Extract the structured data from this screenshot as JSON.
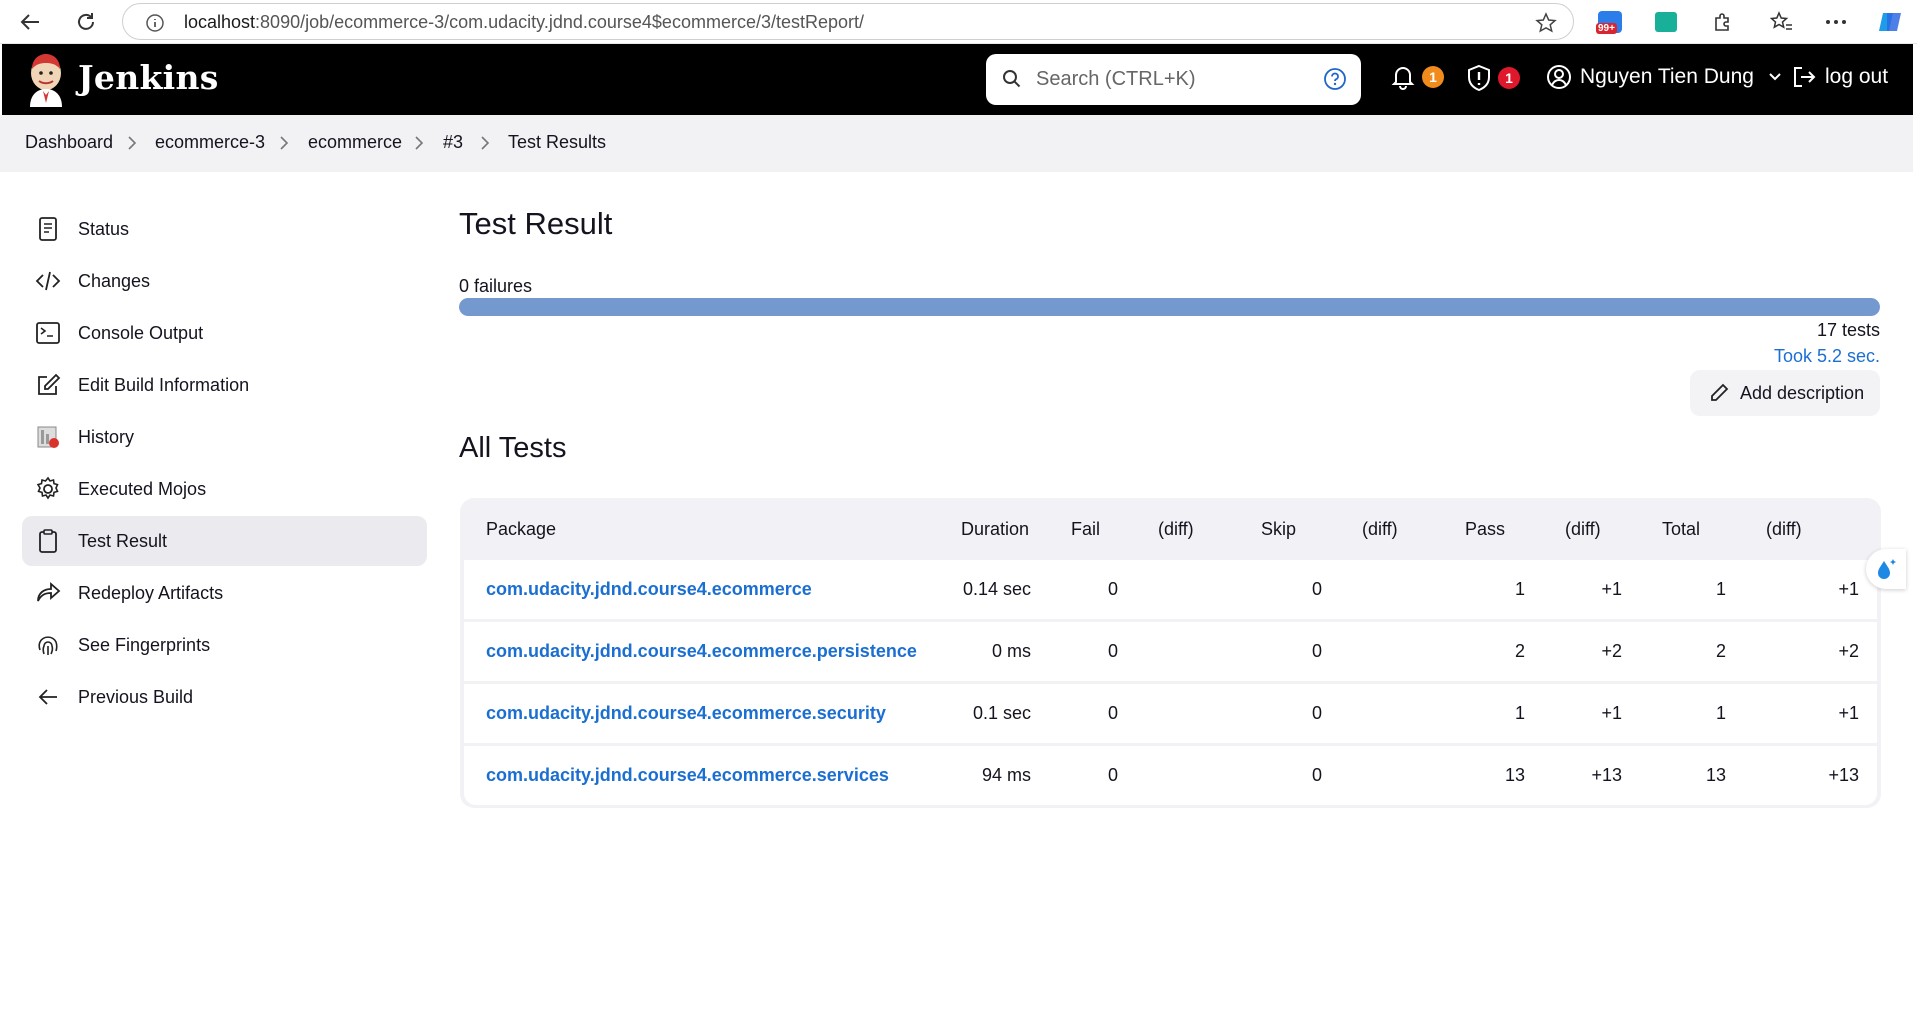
{
  "browser": {
    "url_host": "localhost",
    "url_rest": ":8090/job/ecommerce-3/com.udacity.jdnd.course4$ecommerce/3/testReport/",
    "ext_badge": "99+"
  },
  "header": {
    "brand": "Jenkins",
    "search_placeholder": "Search (CTRL+K)",
    "notifications_count": "1",
    "security_count": "1",
    "user_name": "Nguyen Tien Dung",
    "logout_label": "log out"
  },
  "breadcrumb": [
    "Dashboard",
    "ecommerce-3",
    "ecommerce",
    "#3",
    "Test Results"
  ],
  "sidebar": {
    "items": [
      {
        "label": "Status",
        "icon": "document-icon"
      },
      {
        "label": "Changes",
        "icon": "code-icon"
      },
      {
        "label": "Console Output",
        "icon": "terminal-icon"
      },
      {
        "label": "Edit Build Information",
        "icon": "edit-icon"
      },
      {
        "label": "History",
        "icon": "history-icon"
      },
      {
        "label": "Executed Mojos",
        "icon": "gear-icon"
      },
      {
        "label": "Test Result",
        "icon": "clipboard-icon"
      },
      {
        "label": "Redeploy Artifacts",
        "icon": "redeploy-icon"
      },
      {
        "label": "See Fingerprints",
        "icon": "fingerprint-icon"
      },
      {
        "label": "Previous Build",
        "icon": "arrow-left-icon"
      }
    ]
  },
  "main": {
    "title": "Test Result",
    "failures_text": "0 failures",
    "fail_ratio": 0,
    "tests_text": "17 tests",
    "took_text": "Took 5.2 sec.",
    "add_description": "Add description",
    "all_tests_title": "All Tests"
  },
  "table": {
    "headers": [
      "Package",
      "Duration",
      "Fail",
      "(diff)",
      "Skip",
      "(diff)",
      "Pass",
      "(diff)",
      "Total",
      "(diff)"
    ],
    "rows": [
      {
        "package": "com.udacity.jdnd.course4.ecommerce",
        "duration": "0.14 sec",
        "fail": "0",
        "fail_diff": "",
        "skip": "0",
        "skip_diff": "",
        "pass": "1",
        "pass_diff": "+1",
        "total": "1",
        "total_diff": "+1"
      },
      {
        "package": "com.udacity.jdnd.course4.ecommerce.persistence",
        "duration": "0 ms",
        "fail": "0",
        "fail_diff": "",
        "skip": "0",
        "skip_diff": "",
        "pass": "2",
        "pass_diff": "+2",
        "total": "2",
        "total_diff": "+2"
      },
      {
        "package": "com.udacity.jdnd.course4.ecommerce.security",
        "duration": "0.1 sec",
        "fail": "0",
        "fail_diff": "",
        "skip": "0",
        "skip_diff": "",
        "pass": "1",
        "pass_diff": "+1",
        "total": "1",
        "total_diff": "+1"
      },
      {
        "package": "com.udacity.jdnd.course4.ecommerce.services",
        "duration": "94 ms",
        "fail": "0",
        "fail_diff": "",
        "skip": "0",
        "skip_diff": "",
        "pass": "13",
        "pass_diff": "+13",
        "total": "13",
        "total_diff": "+13"
      }
    ]
  },
  "colors": {
    "accent_link": "#1b6fd2",
    "progress_pass": "#7399cf",
    "badge_orange": "#f08b1c",
    "badge_red": "#e0182b"
  }
}
